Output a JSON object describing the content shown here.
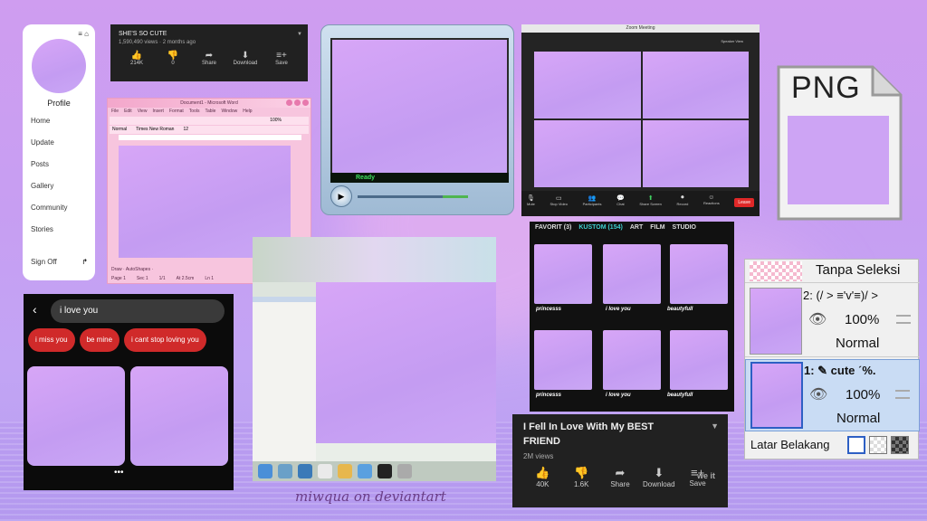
{
  "profile": {
    "name": "Profile",
    "menu": [
      "Home",
      "Update",
      "Posts",
      "Gallery",
      "Community",
      "Stories"
    ],
    "signoff": "Sign Off"
  },
  "yt_small": {
    "title": "SHE'S SO CUTE",
    "views": "1,590,490 views · 2 months ago",
    "actions": [
      {
        "icon": "thumbs-up-icon",
        "label": "214K"
      },
      {
        "icon": "thumbs-down-icon",
        "label": "0"
      },
      {
        "icon": "share-icon",
        "label": "Share"
      },
      {
        "icon": "download-icon",
        "label": "Download"
      },
      {
        "icon": "save-icon",
        "label": "Save"
      }
    ]
  },
  "word": {
    "title": "Document1 - Microsoft Word",
    "menu": [
      "File",
      "Edit",
      "View",
      "Insert",
      "Format",
      "Tools",
      "Table",
      "Window",
      "Help"
    ],
    "style": "Normal",
    "font": "Times New Roman",
    "size": "12",
    "zoom": "100%",
    "draw": "Draw · AutoShapes ·",
    "status": [
      "Page 1",
      "Sec 1",
      "1/1",
      "At 2.5cm",
      "Ln 1"
    ]
  },
  "wmp": {
    "status": "Ready"
  },
  "zoom": {
    "title": "Zoom Meeting",
    "speaker_view": "Speaker View",
    "buttons": [
      "Mute",
      "Stop Video",
      "Participants",
      "Chat",
      "Share Screen",
      "Record",
      "Reactions"
    ],
    "leave": "Leave"
  },
  "png_icon": {
    "label": "PNG"
  },
  "chat": {
    "search_value": "i love you",
    "chips": [
      "i miss you",
      "be mine",
      "i cant stop loving you"
    ]
  },
  "gallery": {
    "tabs": [
      "FAVORIT (3)",
      "KUSTOM (154)",
      "ART",
      "FILM",
      "STUDIO"
    ],
    "captions": [
      "princesss",
      "i love you",
      "beautyfull",
      "princesss",
      "i love you",
      "beautyfull"
    ]
  },
  "yt_large": {
    "title": "I Fell In Love With My BEST FRIEND",
    "views": "2M views",
    "actions": [
      {
        "icon": "thumbs-up-icon",
        "label": "40K"
      },
      {
        "icon": "thumbs-down-icon",
        "label": "1.6K"
      },
      {
        "icon": "share-icon",
        "label": "Share"
      },
      {
        "icon": "download-icon",
        "label": "Download"
      },
      {
        "icon": "save-icon",
        "label": "Save"
      }
    ],
    "watermark": "we it"
  },
  "layers": {
    "top_label": "Tanpa Seleksi",
    "layer2": {
      "name": "2:   (/ ˃ ≡'v'≡)/ ˃",
      "opacity": "100%",
      "mode": "Normal"
    },
    "layer1": {
      "name": "1:   ✎ cute ˊ%.",
      "opacity": "100%",
      "mode": "Normal"
    },
    "background_label": "Latar Belakang"
  },
  "credit": "miwqua on deviantart"
}
